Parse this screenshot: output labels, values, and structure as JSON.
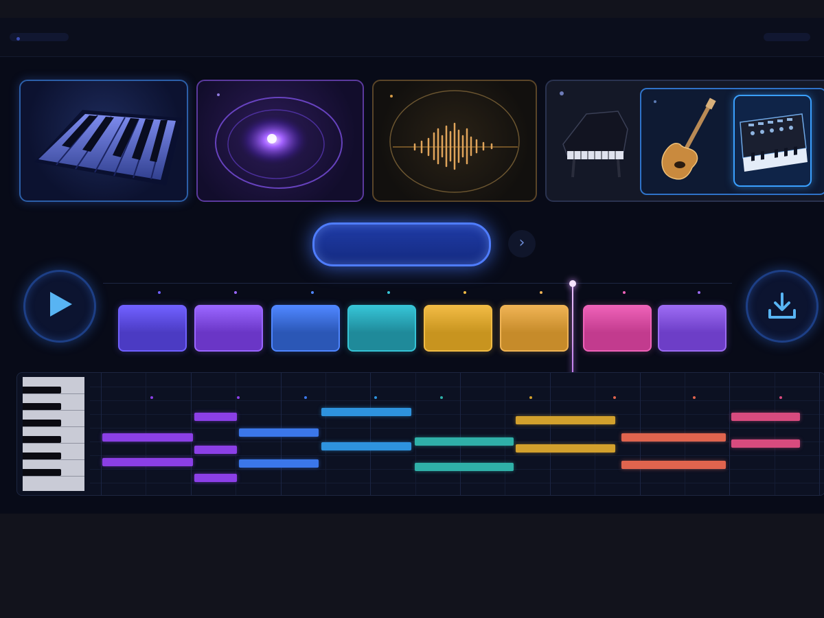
{
  "header": {
    "left_label": "",
    "right_label": ""
  },
  "instrument_cards": [
    {
      "id": "piano-keys",
      "icon": "piano-keys",
      "accent": "#2c5fa8"
    },
    {
      "id": "nebula",
      "icon": "nebula-orb",
      "accent": "#7a4fe0"
    },
    {
      "id": "waveform",
      "icon": "sound-wave",
      "accent": "#d19a45"
    },
    {
      "id": "instrument-group",
      "icons": [
        "grand-piano",
        "electric-guitar",
        "synthesizer"
      ],
      "selected": "synthesizer",
      "accent": "#3aa0ff"
    }
  ],
  "generate_button": {
    "label": "",
    "color": "#4f7dff"
  },
  "next_button": {
    "icon": "chevron-right",
    "glyph": "›"
  },
  "transport": {
    "play_icon": "play-triangle",
    "download_icon": "download-arrow"
  },
  "pads": [
    {
      "color": "#4b3bc3",
      "glow": "#7060ff"
    },
    {
      "color": "#6a36c6",
      "glow": "#9a66ff"
    },
    {
      "color": "#2b57b6",
      "glow": "#4f86ff"
    },
    {
      "color": "#1f8a9a",
      "glow": "#36c4d6"
    },
    {
      "color": "#c8941f",
      "glow": "#f1bb44"
    },
    {
      "color": "#c68b2a",
      "glow": "#efb354"
    },
    {
      "color": "#c23b8e",
      "glow": "#ee62b8"
    },
    {
      "color": "#6d3ec7",
      "glow": "#9c6bf3"
    }
  ],
  "playhead_position": 0.74,
  "piano_roll": {
    "notes": [
      {
        "start": 0.0,
        "length": 0.126,
        "row": 0.53,
        "color": "#8b3fe6"
      },
      {
        "start": 0.0,
        "length": 0.126,
        "row": 0.73,
        "color": "#8b3fe6"
      },
      {
        "start": 0.128,
        "length": 0.059,
        "row": 0.36,
        "color": "#8b3fe6"
      },
      {
        "start": 0.128,
        "length": 0.059,
        "row": 0.63,
        "color": "#8b3fe6"
      },
      {
        "start": 0.128,
        "length": 0.059,
        "row": 0.86,
        "color": "#8b3fe6"
      },
      {
        "start": 0.19,
        "length": 0.111,
        "row": 0.49,
        "color": "#3b77ea"
      },
      {
        "start": 0.19,
        "length": 0.111,
        "row": 0.74,
        "color": "#3b77ea"
      },
      {
        "start": 0.305,
        "length": 0.125,
        "row": 0.32,
        "color": "#2e93de"
      },
      {
        "start": 0.305,
        "length": 0.125,
        "row": 0.6,
        "color": "#2e93de"
      },
      {
        "start": 0.435,
        "length": 0.138,
        "row": 0.56,
        "color": "#2fb0a8"
      },
      {
        "start": 0.435,
        "length": 0.138,
        "row": 0.77,
        "color": "#2fb0a8"
      },
      {
        "start": 0.576,
        "length": 0.138,
        "row": 0.39,
        "color": "#d2a02d"
      },
      {
        "start": 0.576,
        "length": 0.138,
        "row": 0.62,
        "color": "#d2a02d"
      },
      {
        "start": 0.723,
        "length": 0.145,
        "row": 0.53,
        "color": "#e0644e"
      },
      {
        "start": 0.723,
        "length": 0.145,
        "row": 0.75,
        "color": "#e0644e"
      },
      {
        "start": 0.876,
        "length": 0.095,
        "row": 0.36,
        "color": "#d84b7e"
      },
      {
        "start": 0.876,
        "length": 0.095,
        "row": 0.58,
        "color": "#d84b7e"
      }
    ]
  }
}
